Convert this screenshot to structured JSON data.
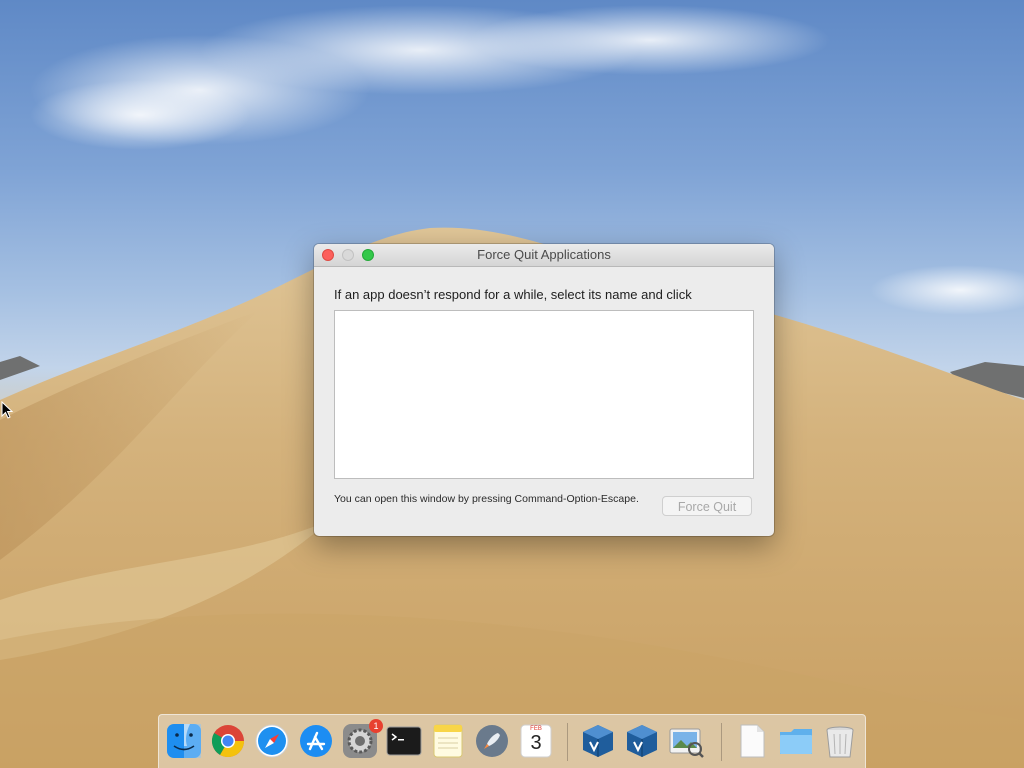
{
  "window": {
    "title": "Force Quit Applications",
    "prompt": "If an app doesn’t respond for a while, select its name and click",
    "hint": "You can open this window by pressing Command-Option-Escape.",
    "force_quit_label": "Force Quit"
  },
  "dock": {
    "apps": [
      {
        "name": "Finder",
        "icon": "finder-icon"
      },
      {
        "name": "Google Chrome",
        "icon": "chrome-icon"
      },
      {
        "name": "Safari",
        "icon": "safari-icon"
      },
      {
        "name": "App Store",
        "icon": "app-store-icon"
      },
      {
        "name": "System Preferences",
        "icon": "system-preferences-icon",
        "badge": "1"
      },
      {
        "name": "Terminal",
        "icon": "terminal-icon"
      },
      {
        "name": "Notes",
        "icon": "notes-icon"
      },
      {
        "name": "Launchpad",
        "icon": "launchpad-icon"
      },
      {
        "name": "Calendar",
        "icon": "calendar-icon",
        "month": "FEB",
        "day": "3"
      },
      {
        "name": "VirtualBox",
        "icon": "virtualbox-icon"
      },
      {
        "name": "VirtualBox",
        "icon": "virtualbox-icon"
      },
      {
        "name": "Preview",
        "icon": "preview-icon"
      },
      {
        "name": "Document",
        "icon": "document-icon"
      },
      {
        "name": "Folder",
        "icon": "folder-icon"
      },
      {
        "name": "Trash",
        "icon": "trash-icon"
      }
    ]
  },
  "colors": {
    "close": "#fc605c",
    "minimize_disabled": "#d9d9d9",
    "zoom": "#34c84a",
    "badge": "#e8402f"
  }
}
